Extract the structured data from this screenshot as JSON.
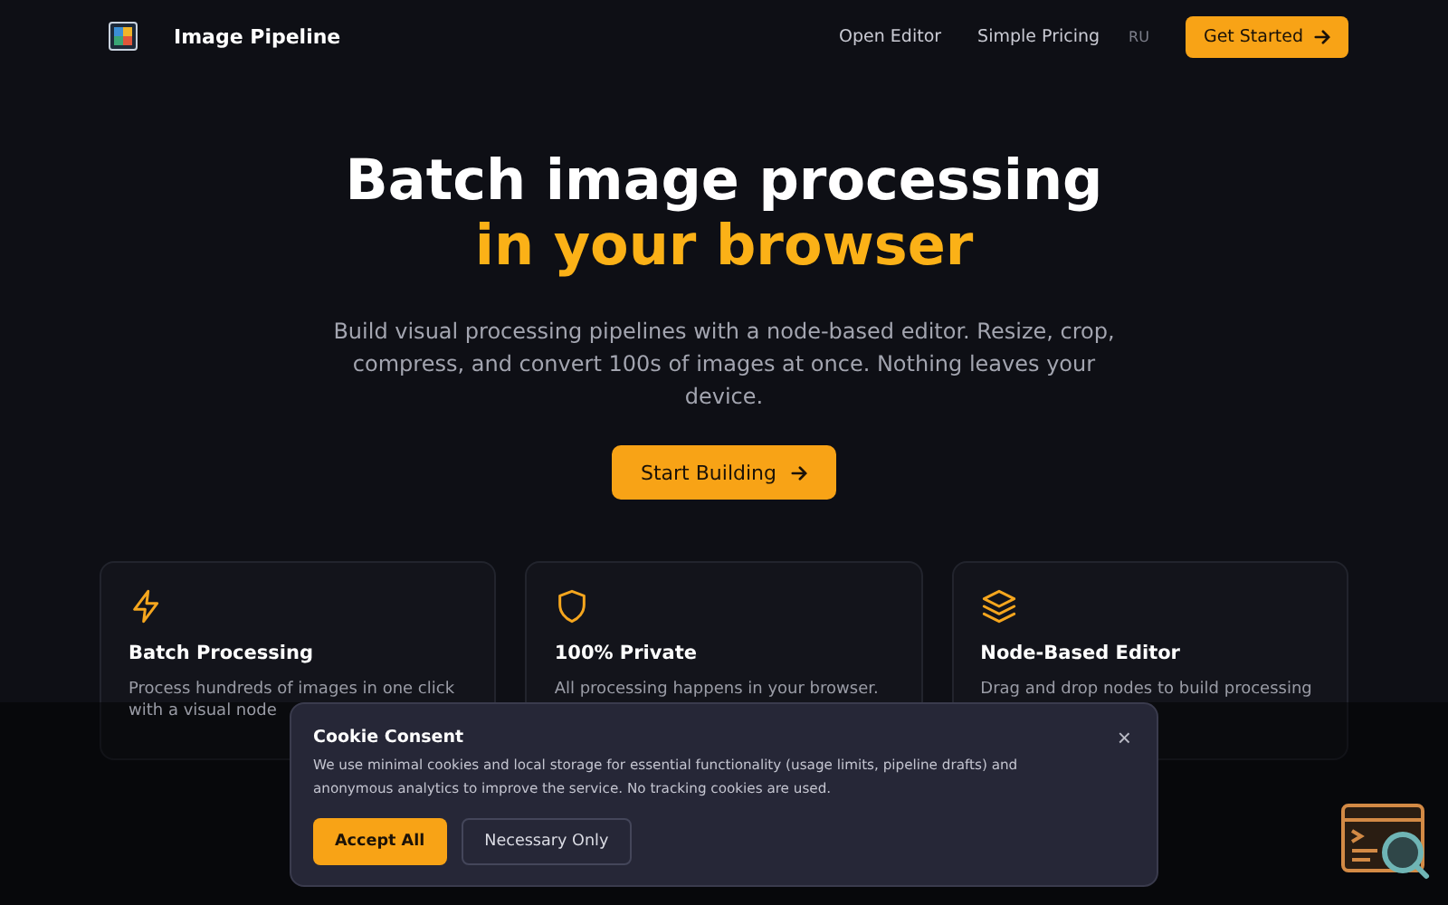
{
  "header": {
    "brand": "Image Pipeline",
    "nav": [
      "Open Editor",
      "Simple Pricing"
    ],
    "language": {
      "label": "RU",
      "selected": false
    },
    "cta": "Get Started"
  },
  "hero": {
    "title": "Batch image processing",
    "highlight": "in your browser",
    "subtitle": "Build visual processing pipelines with a node-based editor. Resize, crop, compress, and convert 100s of images at once. Nothing leaves your device.",
    "button": "Start Building"
  },
  "features": [
    {
      "title": "Batch Processing",
      "description": "Process hundreds of images in one click with a visual node"
    },
    {
      "title": "100% Private",
      "description": "All processing happens in your browser."
    },
    {
      "title": "Node-Based Editor",
      "description": "Drag and drop nodes to build processing"
    }
  ],
  "cookie_dialog": {
    "title": "Cookie Consent",
    "text": "We use minimal cookies and local storage for essential functionality (usage limits, pipeline drafts) and anonymous analytics to improve the service. No tracking cookies are used.",
    "close": "×",
    "buttons": [
      {
        "label": "Accept All",
        "kind": "primary"
      },
      {
        "label": "Necessary Only",
        "kind": "secondary"
      }
    ]
  }
}
